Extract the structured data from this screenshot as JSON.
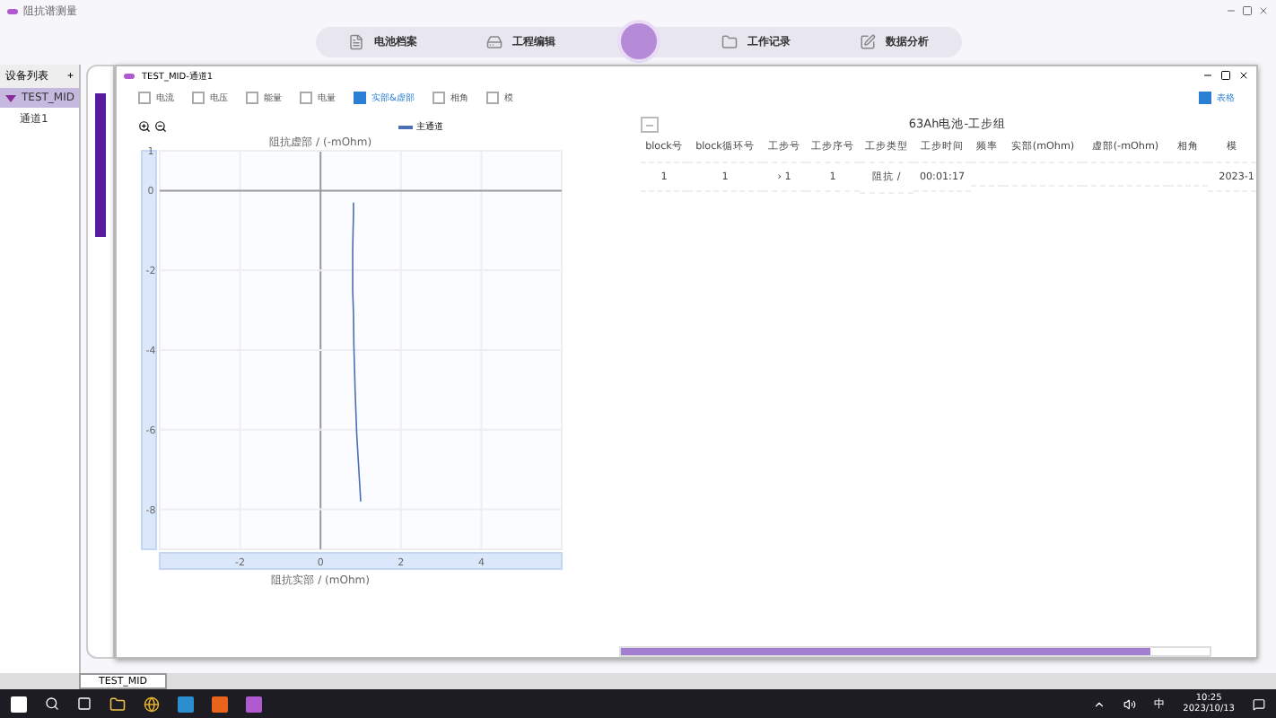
{
  "app": {
    "title": "阻抗谱测量"
  },
  "nav": [
    {
      "label": "电池档案",
      "kind": "doc",
      "selected": false
    },
    {
      "label": "工程编辑",
      "kind": "drive",
      "selected": false
    },
    {
      "label": "工作记录",
      "kind": "folder",
      "selected": false
    },
    {
      "label": "数据分析",
      "kind": "edit",
      "selected": false
    }
  ],
  "sidebar": {
    "title": "设备列表",
    "add": "+",
    "items": [
      {
        "label": "TEST_MID",
        "selected": true,
        "expanded": true,
        "children": [
          {
            "label": "通道1",
            "selected": false
          }
        ]
      }
    ]
  },
  "subwindow": {
    "title": "TEST_MID-通道1",
    "options": [
      {
        "label": "电流",
        "checked": false
      },
      {
        "label": "电压",
        "checked": false
      },
      {
        "label": "能量",
        "checked": false
      },
      {
        "label": "电量",
        "checked": false
      },
      {
        "label": "实部&虚部",
        "checked": true
      },
      {
        "label": "相角",
        "checked": false
      },
      {
        "label": "模",
        "checked": false
      }
    ],
    "table_toggle": {
      "label": "表格",
      "checked": true
    },
    "chart": {
      "chart_data": {
        "type": "line",
        "grid": true,
        "xlabel": "阻抗实部 / (mOhm)",
        "ylabel": "阻抗虚部 / (-mOhm)",
        "xlim": [
          -4,
          6
        ],
        "ylim": [
          -9,
          1
        ],
        "xticks": [
          -2,
          0,
          2,
          4
        ],
        "yticks": [
          1,
          0,
          -2,
          -4,
          -6,
          -8
        ],
        "x": [
          0.82,
          0.82,
          0.81,
          0.8,
          0.8,
          0.8,
          0.82,
          0.83,
          0.86,
          0.9,
          1.0
        ],
        "series": [
          {
            "name": "主通道",
            "color": "#4a6fb5",
            "values": [
              -0.3,
              -0.6,
              -1.0,
              -1.5,
              -2.0,
              -2.5,
              -3.1,
              -3.9,
              -5.0,
              -6.1,
              -7.8
            ]
          }
        ]
      }
    },
    "table": {
      "title": "63Ah电池-工步组",
      "collapse": "—",
      "columns": [
        "block号",
        "block循环号",
        "工步号",
        "工步序号",
        "工步类型",
        "工步时间",
        "频率",
        "实部(mOhm)",
        "虚部(-mOhm)",
        "相角",
        "模"
      ],
      "rows": [
        {
          "cells": [
            "1",
            "1",
            "› 1",
            "1",
            "阻抗 /",
            "00:01:17",
            "",
            "",
            "",
            "",
            "2023-1"
          ]
        }
      ]
    },
    "scroll": {
      "level": 0.9
    }
  },
  "bottom_tab": {
    "label": "TEST_MID"
  },
  "taskbar": {
    "time": "10:25",
    "date": "2023/10/13",
    "ime": "中"
  }
}
